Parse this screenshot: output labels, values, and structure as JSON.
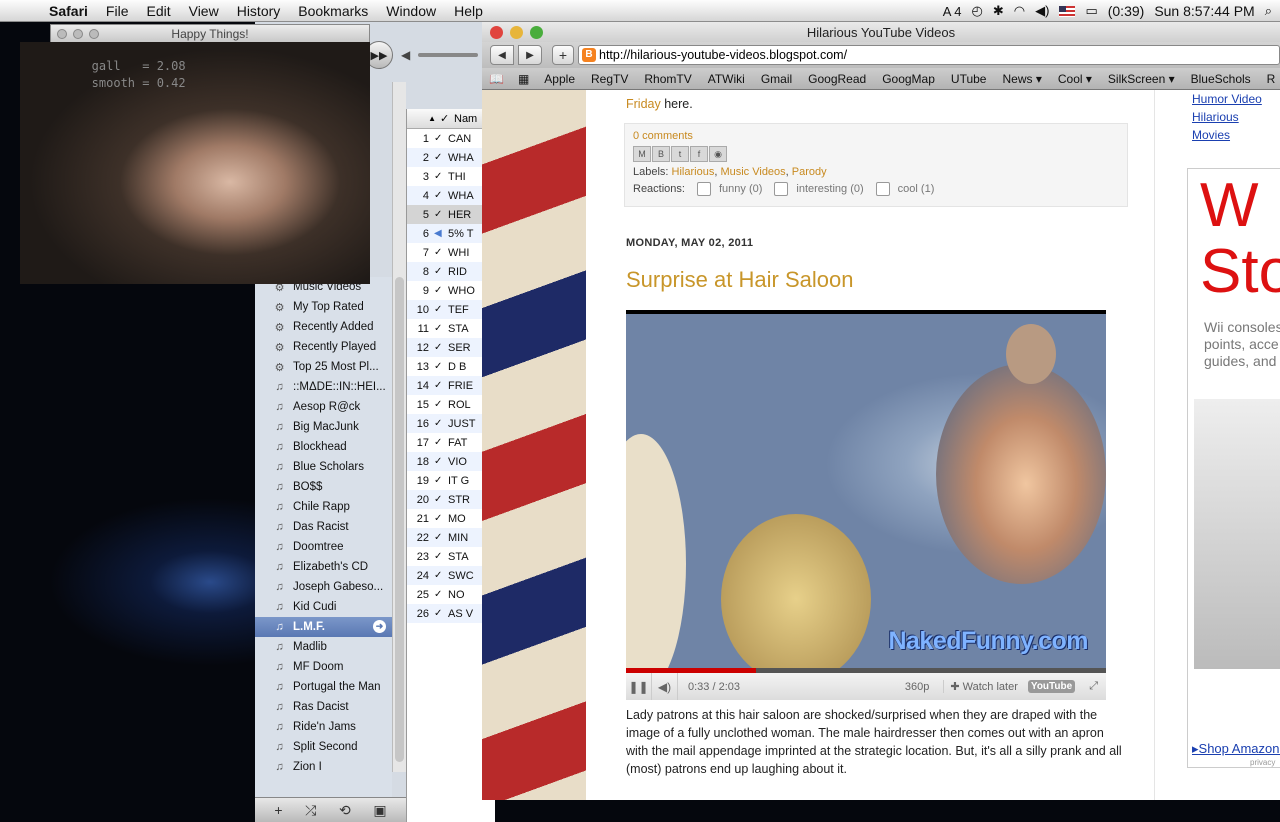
{
  "menubar": {
    "app": "Safari",
    "items": [
      "File",
      "Edit",
      "View",
      "History",
      "Bookmarks",
      "Window",
      "Help"
    ],
    "status": {
      "adobe_count": "4",
      "battery": "(0:39)",
      "clock": "Sun 8:57:44 PM"
    }
  },
  "webcam": {
    "title": "Happy Things!",
    "overlay": "   gall   = 2.08\n   smooth = 0.42"
  },
  "itunes": {
    "sidebar_items": [
      {
        "label": "Music Videos",
        "icon": "gear-icon"
      },
      {
        "label": "My Top Rated",
        "icon": "gear-icon"
      },
      {
        "label": "Recently Added",
        "icon": "gear-icon"
      },
      {
        "label": "Recently Played",
        "icon": "gear-icon"
      },
      {
        "label": "Top 25 Most Pl...",
        "icon": "gear-icon"
      },
      {
        "label": "::MΔDE::IN::HEI...",
        "icon": "playlist-icon"
      },
      {
        "label": "Aesop R@ck",
        "icon": "playlist-icon"
      },
      {
        "label": "Big MacJunk",
        "icon": "playlist-icon"
      },
      {
        "label": "Blockhead",
        "icon": "playlist-icon"
      },
      {
        "label": "Blue Scholars",
        "icon": "playlist-icon"
      },
      {
        "label": "BO$$",
        "icon": "playlist-icon"
      },
      {
        "label": "Chile Rapp",
        "icon": "playlist-icon"
      },
      {
        "label": "Das Racist",
        "icon": "playlist-icon"
      },
      {
        "label": "Doomtree",
        "icon": "playlist-icon"
      },
      {
        "label": "Elizabeth's CD",
        "icon": "playlist-icon"
      },
      {
        "label": "Joseph Gabeso...",
        "icon": "playlist-icon"
      },
      {
        "label": "Kid Cudi",
        "icon": "playlist-icon"
      },
      {
        "label": "L.M.F.",
        "icon": "playlist-icon",
        "selected": true
      },
      {
        "label": "Madlib",
        "icon": "playlist-icon"
      },
      {
        "label": "MF Doom",
        "icon": "playlist-icon"
      },
      {
        "label": "Portugal the Man",
        "icon": "playlist-icon"
      },
      {
        "label": "Ras Dacist",
        "icon": "playlist-icon"
      },
      {
        "label": "Ride'n Jams",
        "icon": "playlist-icon"
      },
      {
        "label": "Split Second",
        "icon": "playlist-icon"
      },
      {
        "label": "Zion I",
        "icon": "playlist-icon"
      }
    ],
    "track_header": "Nam",
    "tracks": [
      {
        "n": "1",
        "t": "CAN"
      },
      {
        "n": "2",
        "t": "WHA"
      },
      {
        "n": "3",
        "t": "THI"
      },
      {
        "n": "4",
        "t": "WHA"
      },
      {
        "n": "5",
        "t": "HER",
        "sel": true
      },
      {
        "n": "6",
        "t": "5% T",
        "playing": true
      },
      {
        "n": "7",
        "t": "WHI"
      },
      {
        "n": "8",
        "t": "RID"
      },
      {
        "n": "9",
        "t": "WHO"
      },
      {
        "n": "10",
        "t": "TEF"
      },
      {
        "n": "11",
        "t": "STA"
      },
      {
        "n": "12",
        "t": "SER"
      },
      {
        "n": "13",
        "t": "D B"
      },
      {
        "n": "14",
        "t": "FRIE"
      },
      {
        "n": "15",
        "t": "ROL"
      },
      {
        "n": "16",
        "t": "JUST"
      },
      {
        "n": "17",
        "t": "FAT"
      },
      {
        "n": "18",
        "t": "VIO"
      },
      {
        "n": "19",
        "t": "IT G"
      },
      {
        "n": "20",
        "t": "STR"
      },
      {
        "n": "21",
        "t": "MO"
      },
      {
        "n": "22",
        "t": "MIN"
      },
      {
        "n": "23",
        "t": "STA"
      },
      {
        "n": "24",
        "t": "SWC"
      },
      {
        "n": "25",
        "t": "NO"
      },
      {
        "n": "26",
        "t": "AS V"
      }
    ]
  },
  "safari": {
    "title": "Hilarious YouTube Videos",
    "url": "http://hilarious-youtube-videos.blogspot.com/",
    "bookmarks": [
      "Apple",
      "RegTV",
      "RhomTV",
      "ATWiki",
      "Gmail",
      "GoogRead",
      "GoogMap",
      "UTube",
      "News ▾",
      "Cool ▾",
      "SilkScreen ▾",
      "BlueSchols",
      "R"
    ]
  },
  "post_prev": {
    "link": "Friday",
    "rest": " here.",
    "comments": "0 comments",
    "labels_prefix": "Labels: ",
    "labels": [
      "Hilarious",
      "Music Videos",
      "Parody"
    ],
    "reactions_label": "Reactions:",
    "reactions": [
      "funny (0)",
      "interesting (0)",
      "cool (1)"
    ]
  },
  "post": {
    "date": "MONDAY, MAY 02, 2011",
    "title": "Surprise at Hair Saloon",
    "watermark": "NakedFunny.com",
    "video_progress_fraction": 0.27,
    "time": "0:33 / 2:03",
    "quality": "360p",
    "watch_later": "Watch later",
    "yt": "YouTube",
    "description": "Lady patrons at this hair saloon are shocked/surprised when they are draped with the image of a fully unclothed woman. The male hairdresser then comes out with an apron with the mail appendage imprinted at the strategic location. But, it's all a silly prank and all (most) patrons end up laughing about it."
  },
  "right_sidebar": {
    "links": [
      "Humor Video",
      "Hilarious Movies"
    ],
    "ad": {
      "big": "W\nSto",
      "small": "Wii consoles\npoints, acce\nguides, and",
      "shop": "Shop Amazon.",
      "privacy": "privacy"
    }
  }
}
